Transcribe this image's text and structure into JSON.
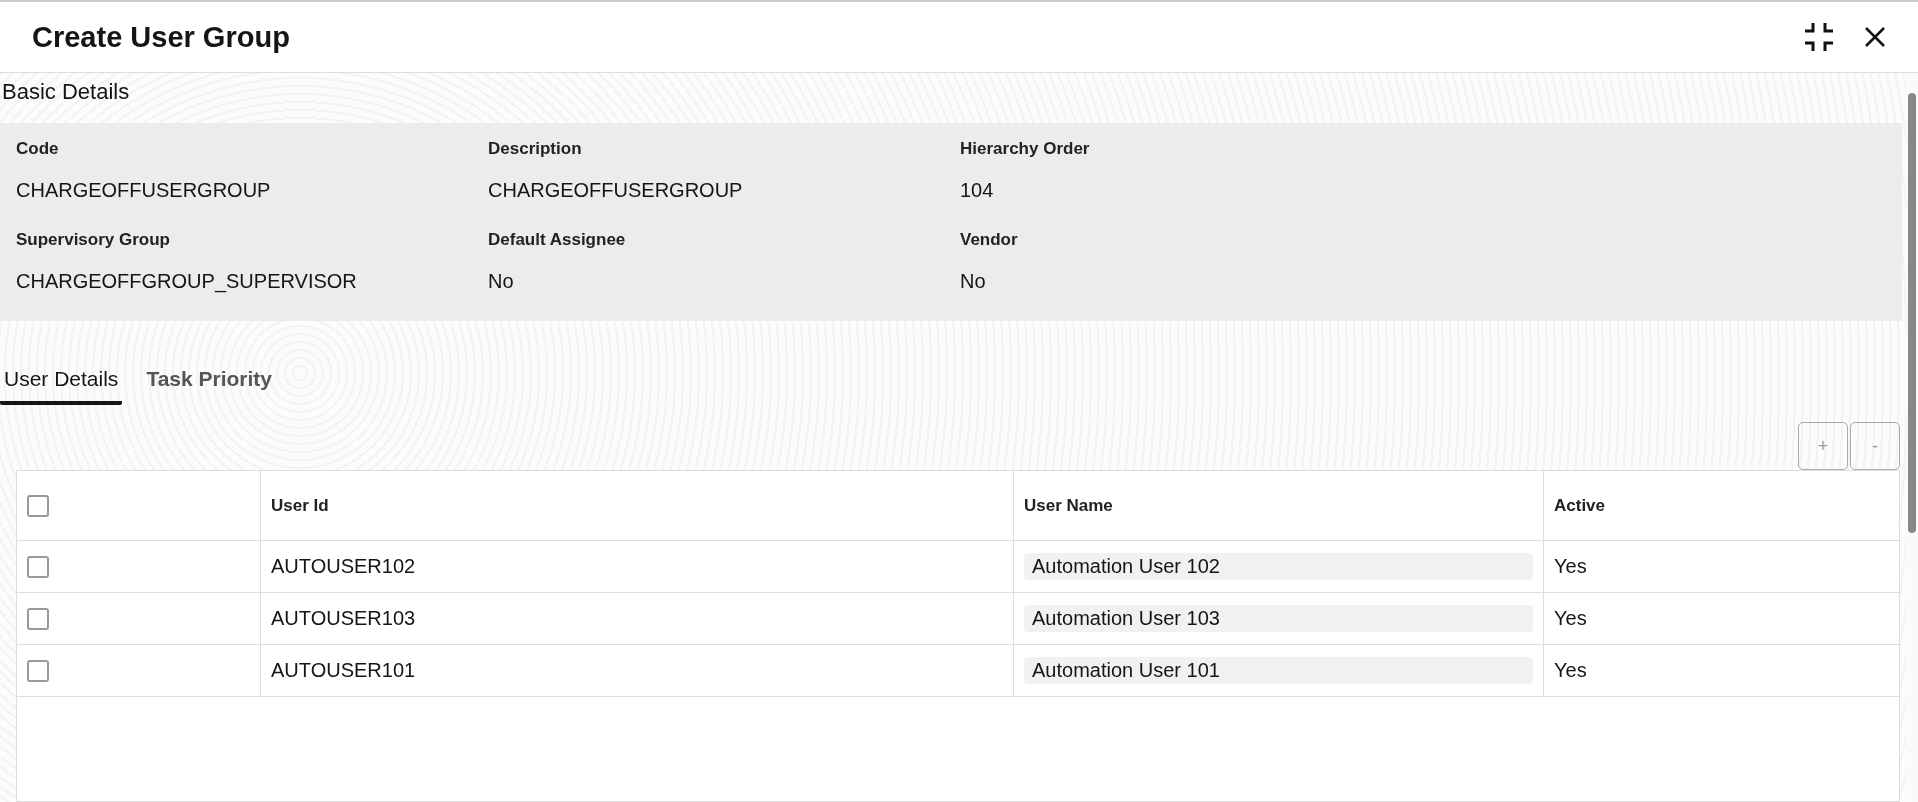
{
  "window": {
    "title": "Create User Group"
  },
  "basic_details": {
    "title": "Basic Details",
    "fields": [
      {
        "label": "Code",
        "value": "CHARGEOFFUSERGROUP"
      },
      {
        "label": "Description",
        "value": "CHARGEOFFUSERGROUP"
      },
      {
        "label": "Hierarchy Order",
        "value": "104"
      },
      {
        "label": "Supervisory Group",
        "value": "CHARGEOFFGROUP_SUPERVISOR"
      },
      {
        "label": "Default Assignee",
        "value": "No"
      },
      {
        "label": "Vendor",
        "value": "No"
      }
    ]
  },
  "tabs": [
    {
      "label": "User Details",
      "selected": true
    },
    {
      "label": "Task Priority",
      "selected": false
    }
  ],
  "table_buttons": [
    "+",
    "-"
  ],
  "table": {
    "columns": [
      "User Id",
      "User Name",
      "Active"
    ],
    "header_checked": false,
    "rows": [
      {
        "checked": false,
        "user_id": "AUTOUSER102",
        "user_name": "Automation User 102",
        "active": "Yes"
      },
      {
        "checked": false,
        "user_id": "AUTOUSER103",
        "user_name": "Automation User 103",
        "active": "Yes"
      },
      {
        "checked": false,
        "user_id": "AUTOUSER101",
        "user_name": "Automation User 101",
        "active": "Yes"
      }
    ]
  }
}
